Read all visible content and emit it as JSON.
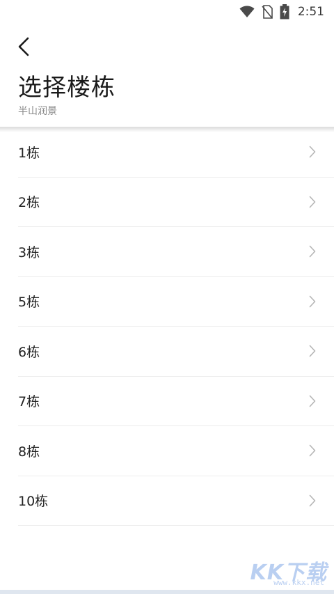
{
  "status_bar": {
    "time": "2:51",
    "icons": [
      "wifi-icon",
      "no-sim-icon",
      "battery-charging-icon"
    ]
  },
  "header": {
    "back_icon": "chevron-left-icon",
    "title": "选择楼栋",
    "subtitle": "半山润景"
  },
  "buildings": [
    {
      "label": "1栋"
    },
    {
      "label": "2栋"
    },
    {
      "label": "3栋"
    },
    {
      "label": "5栋"
    },
    {
      "label": "6栋"
    },
    {
      "label": "7栋"
    },
    {
      "label": "8栋"
    },
    {
      "label": "10栋"
    }
  ],
  "row_icon": "chevron-right-icon",
  "watermark": {
    "text": "KK下载",
    "url": "www.kkx.net"
  },
  "colors": {
    "background": "#ffffff",
    "divider": "#ececec",
    "chevron": "#b5b5b5",
    "subtitle": "#8a8a8a"
  }
}
